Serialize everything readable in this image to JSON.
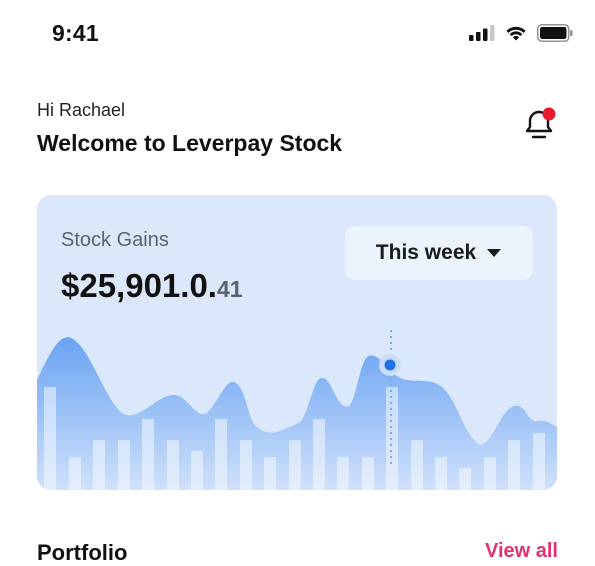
{
  "status_bar": {
    "time": "9:41"
  },
  "header": {
    "greeting": "Hi Rachael",
    "welcome": "Welcome to Leverpay Stock",
    "notification_dot_color": "#e8192c"
  },
  "card": {
    "title": "Stock Gains",
    "amount_main": "$25,901.0.",
    "amount_cents": "41",
    "range": {
      "selected": "This week"
    },
    "area_color": "#7eb0f4",
    "bar_color": "#f5f9ff",
    "marker_color": "#1f6fe5"
  },
  "portfolio": {
    "title": "Portfolio",
    "view_all": "View all"
  }
}
